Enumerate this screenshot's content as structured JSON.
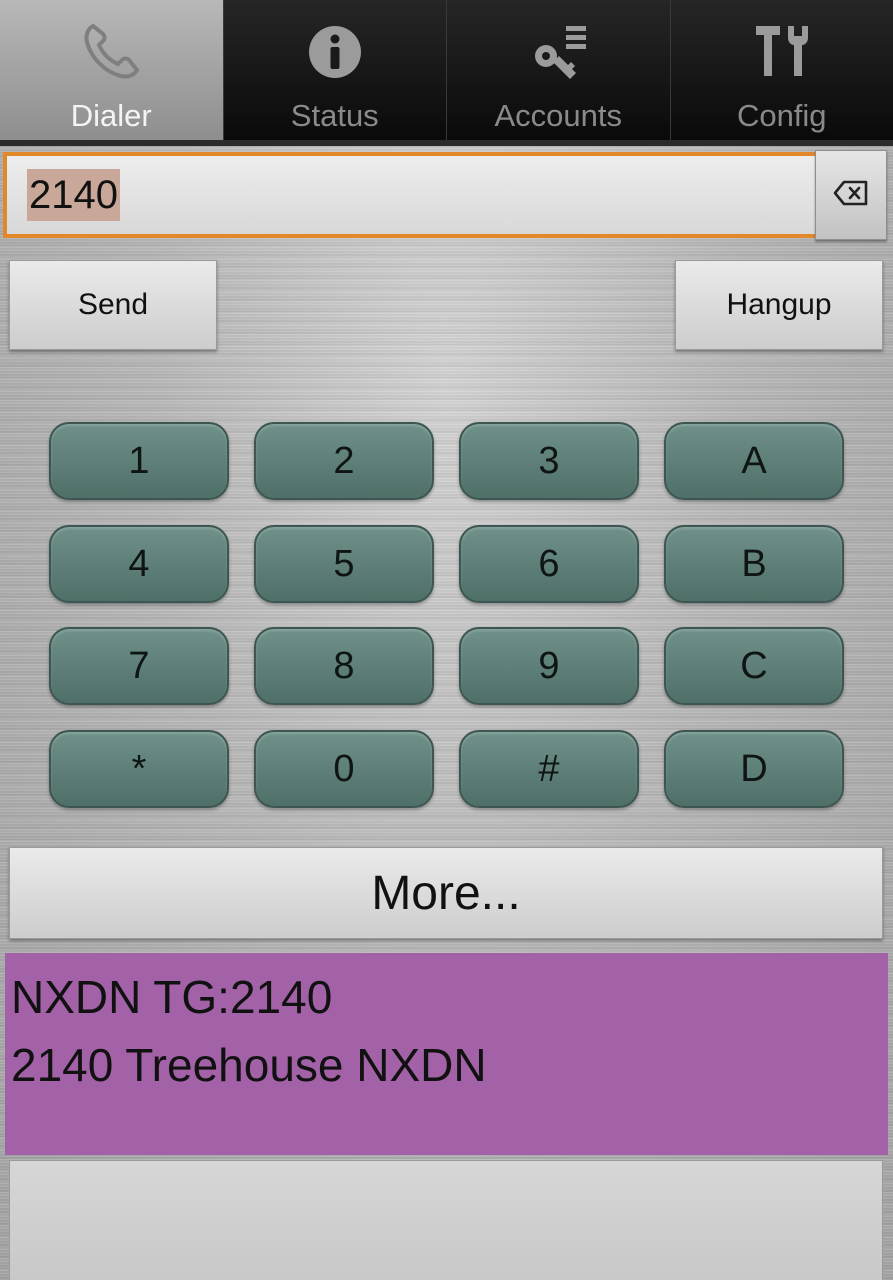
{
  "tabs": [
    {
      "label": "Dialer",
      "icon": "phone-icon",
      "active": true
    },
    {
      "label": "Status",
      "icon": "info-icon",
      "active": false
    },
    {
      "label": "Accounts",
      "icon": "key-list-icon",
      "active": false
    },
    {
      "label": "Config",
      "icon": "tools-icon",
      "active": false
    }
  ],
  "dialer": {
    "number": "2140",
    "backspace_icon": "backspace-icon",
    "send_label": "Send",
    "hangup_label": "Hangup",
    "keypad": [
      [
        "1",
        "2",
        "3",
        "A"
      ],
      [
        "4",
        "5",
        "6",
        "B"
      ],
      [
        "7",
        "8",
        "9",
        "C"
      ],
      [
        "*",
        "0",
        "#",
        "D"
      ]
    ],
    "more_label": "More..."
  },
  "status": {
    "line1": "NXDN TG:2140",
    "line2": "2140 Treehouse NXDN",
    "color": "#a362a8"
  },
  "colors": {
    "accent": "#e1892a",
    "key": "#5e8079"
  }
}
